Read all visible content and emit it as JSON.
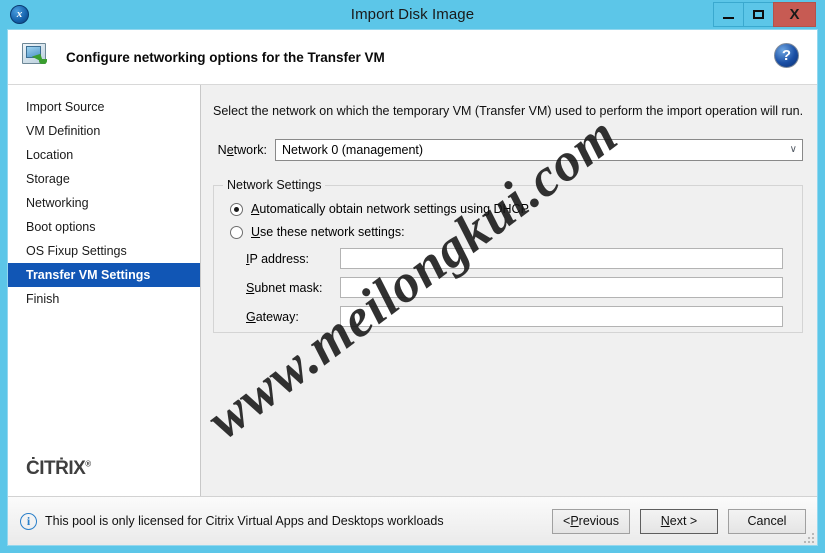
{
  "window": {
    "title": "Import Disk Image",
    "app_icon": "xencenter-icon",
    "minimize_label": "",
    "maximize_label": "",
    "close_label": "X"
  },
  "header": {
    "title": "Configure networking options for the Transfer VM",
    "icon": "import-disk-image-icon",
    "help_label": "?"
  },
  "sidebar": {
    "items": [
      {
        "label": "Import Source",
        "selected": false
      },
      {
        "label": "VM Definition",
        "selected": false
      },
      {
        "label": "Location",
        "selected": false
      },
      {
        "label": "Storage",
        "selected": false
      },
      {
        "label": "Networking",
        "selected": false
      },
      {
        "label": "Boot options",
        "selected": false
      },
      {
        "label": "OS Fixup Settings",
        "selected": false
      },
      {
        "label": "Transfer VM Settings",
        "selected": true
      },
      {
        "label": "Finish",
        "selected": false
      }
    ],
    "logo": "CITRIX"
  },
  "main": {
    "intro": "Select the network on which the temporary VM (Transfer VM) used to perform the import operation will run.",
    "network_label": "Network:",
    "network_value": "Network 0 (management)",
    "combo_arrow": "∨",
    "group": {
      "legend": "Network Settings",
      "radios": [
        {
          "label": "Automatically obtain network settings using DHCP",
          "checked": true
        },
        {
          "label": "Use these network settings:",
          "checked": false
        }
      ],
      "fields": [
        {
          "label": "IP address:",
          "value": ""
        },
        {
          "label": "Subnet mask:",
          "value": ""
        },
        {
          "label": "Gateway:",
          "value": ""
        }
      ]
    }
  },
  "statusbar": {
    "info_icon": "info-icon",
    "message": "This pool is only licensed for Citrix Virtual Apps and Desktops workloads",
    "buttons": {
      "previous": "< Previous",
      "next": "Next >",
      "cancel": "Cancel"
    }
  },
  "watermark": {
    "text": "www.meilongkui.com"
  },
  "colors": {
    "window_frame": "#5cc6e8",
    "selected_item": "#1156b5",
    "close_button": "#c75b53",
    "panel_background": "#f0f0f0",
    "accent_blue": "#2a7fc9"
  }
}
